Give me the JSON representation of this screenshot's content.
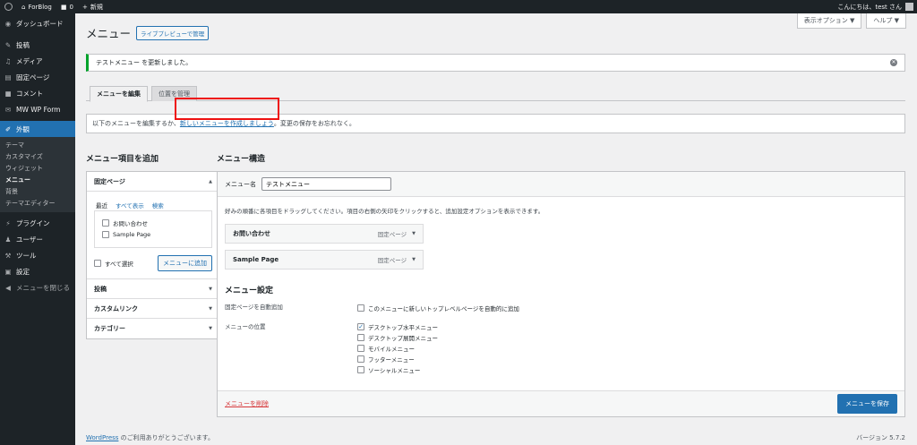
{
  "adminbar": {
    "site_name": "ForBlog",
    "comments_count": "0",
    "new_label": "新規",
    "greeting": "こんにちは、test さん"
  },
  "sidebar": {
    "items": [
      {
        "label": "ダッシュボード",
        "icon": "dashboard-icon"
      },
      {
        "label": "投稿",
        "icon": "pin-icon"
      },
      {
        "label": "メディア",
        "icon": "media-icon"
      },
      {
        "label": "固定ページ",
        "icon": "page-icon"
      },
      {
        "label": "コメント",
        "icon": "comment-icon"
      },
      {
        "label": "MW WP Form",
        "icon": "form-icon"
      },
      {
        "label": "外観",
        "icon": "brush-icon"
      }
    ],
    "submenu": [
      "テーマ",
      "カスタマイズ",
      "ウィジェット",
      "メニュー",
      "背景",
      "テーマエディター"
    ],
    "items2": [
      {
        "label": "プラグイン",
        "icon": "plugin-icon"
      },
      {
        "label": "ユーザー",
        "icon": "user-icon"
      },
      {
        "label": "ツール",
        "icon": "wrench-icon"
      },
      {
        "label": "設定",
        "icon": "settings-icon"
      },
      {
        "label": "メニューを閉じる",
        "icon": "collapse-icon"
      }
    ]
  },
  "screen_meta": {
    "options": "表示オプション ▼",
    "help": "ヘルプ ▼"
  },
  "page": {
    "title": "メニュー",
    "live_preview": "ライブプレビューで管理"
  },
  "notice": {
    "text": "テストメニュー を更新しました。"
  },
  "tabs": [
    "メニューを編集",
    "位置を管理"
  ],
  "manage": {
    "prefix": "以下のメニューを編集するか、",
    "link": "新しいメニューを作成しましょう",
    "suffix": "。変更の保存をお忘れなく。"
  },
  "add_items": {
    "heading": "メニュー項目を追加",
    "pages_title": "固定ページ",
    "inner_tabs": [
      "最近",
      "すべて表示",
      "検索"
    ],
    "pages": [
      "お問い合わせ",
      "Sample Page"
    ],
    "select_all": "すべて選択",
    "add_button": "メニューに追加",
    "sections": [
      "投稿",
      "カスタムリンク",
      "カテゴリー"
    ]
  },
  "structure": {
    "heading": "メニュー構造",
    "name_label": "メニュー名",
    "name_value": "テストメニュー",
    "instructions": "好みの順番に各項目をドラッグしてください。項目の右側の矢印をクリックすると、追加設定オプションを表示できます。",
    "items": [
      {
        "title": "お問い合わせ",
        "type": "固定ページ"
      },
      {
        "title": "Sample Page",
        "type": "固定ページ"
      }
    ],
    "settings_heading": "メニュー設定",
    "auto_add_label": "固定ページを自動追加",
    "auto_add_option": "このメニューに新しいトップレベルページを自動的に追加",
    "location_label": "メニューの位置",
    "locations": [
      {
        "label": "デスクトップ水平メニュー",
        "checked": true
      },
      {
        "label": "デスクトップ展開メニュー",
        "checked": false
      },
      {
        "label": "モバイルメニュー",
        "checked": false
      },
      {
        "label": "フッターメニュー",
        "checked": false
      },
      {
        "label": "ソーシャルメニュー",
        "checked": false
      }
    ],
    "delete": "メニューを削除",
    "save": "メニューを保存"
  },
  "footer": {
    "link": "WordPress",
    "text": " のご利用ありがとうございます。",
    "version": "バージョン 5.7.2"
  },
  "colors": {
    "accent": "#2271b1",
    "sidebar": "#1d2327",
    "highlight": "#ee1111",
    "success": "#00a32a"
  }
}
